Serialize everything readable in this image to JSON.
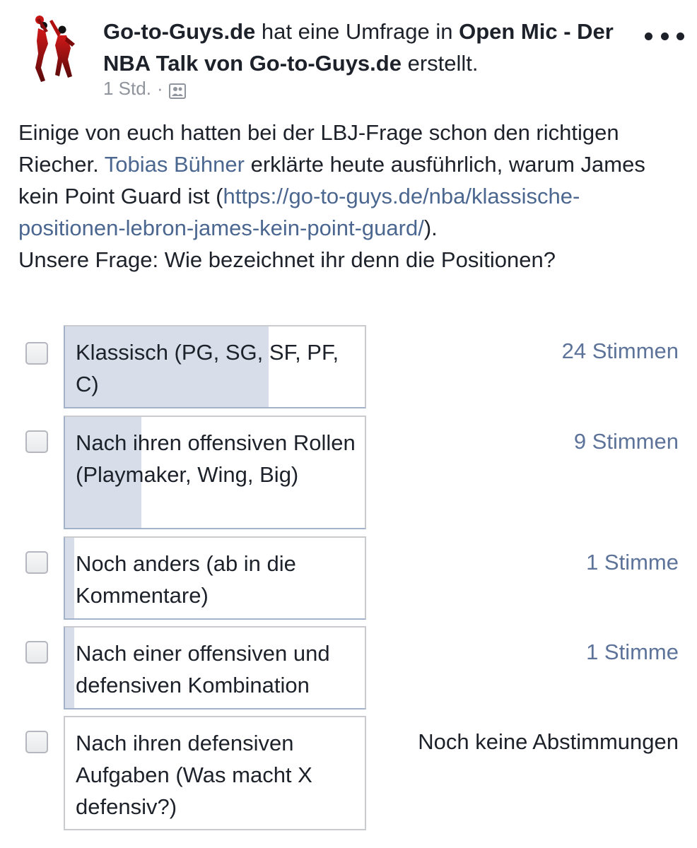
{
  "post": {
    "author": "Go-to-Guys.de",
    "action_text": "hat eine Umfrage in",
    "group": "Open Mic - Der NBA Talk von Go-to-Guys.de",
    "action_suffix": "erstellt.",
    "time": "1 Std.",
    "separator": "·",
    "audience_icon": "group-icon",
    "more_icon": "more-horizontal-icon"
  },
  "body": {
    "text_1": "Einige von euch hatten bei der LBJ-Frage schon den richtigen Riecher. ",
    "mention": "Tobias Bühner",
    "text_2": " erklärte heute ausführlich, warum James kein Point Guard ist (",
    "link": "https://go-to-guys.de/nba/klassische-positionen-lebron-james-kein-point-guard/",
    "text_3": ").",
    "question": "Unsere Frage: Wie bezeichnet ihr denn die Positionen?"
  },
  "poll": {
    "options": [
      {
        "label": "Klassisch (PG, SG, SF, PF, C)",
        "votes_text": "24 Stimmen",
        "votes": 24,
        "fill_fraction": 0.68
      },
      {
        "label": "Nach ihren offensiven Rollen (Playmaker, Wing, Big)",
        "votes_text": "9 Stimmen",
        "votes": 9,
        "fill_fraction": 0.255
      },
      {
        "label": "Noch anders (ab in die Kommentare)",
        "votes_text": "1 Stimme",
        "votes": 1,
        "fill_fraction": 0.03
      },
      {
        "label": "Nach einer offensiven und defensiven Kombination",
        "votes_text": "1 Stimme",
        "votes": 1,
        "fill_fraction": 0.03
      },
      {
        "label": "Nach ihren defensiven Aufgaben (Was macht X defensiv?)",
        "votes_text": "Noch keine Abstimmungen",
        "votes": 0,
        "fill_fraction": 0
      }
    ]
  },
  "colors": {
    "link": "#4b6790",
    "vote_count": "#5d7399",
    "fill": "#d7dde9",
    "meta": "#90949c"
  }
}
